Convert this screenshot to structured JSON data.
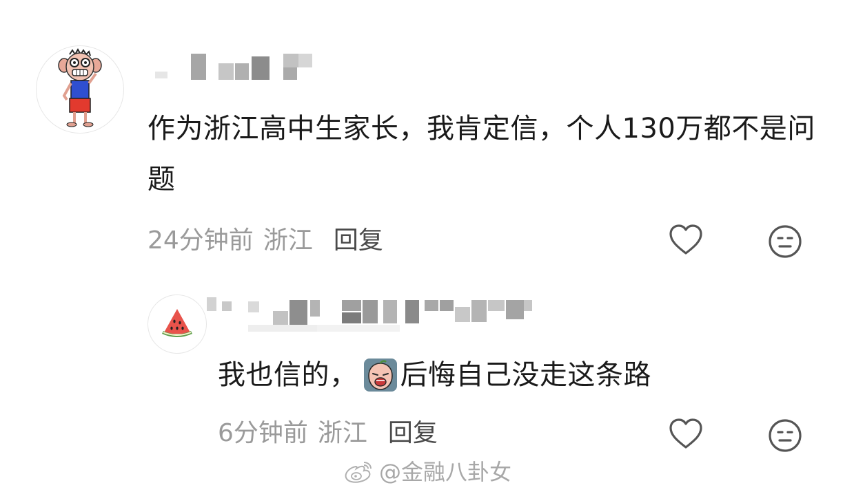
{
  "comment": {
    "text": "作为浙江高中生家长，我肯定信，个人130万都不是问题",
    "time": "24分钟前",
    "location": "浙江",
    "reply_label": "回复",
    "icons": {
      "avatar": "cartoon-boy-avatar",
      "like": "heart-outline-icon",
      "dislike": "meh-face-icon"
    }
  },
  "reply": {
    "text_before": "我也信的，",
    "text_after": "后悔自己没走这条路",
    "time": "6分钟前",
    "location": "浙江",
    "reply_label": "回复",
    "icons": {
      "avatar": "watermelon-avatar",
      "sticker": "crying-peach-emoji",
      "like": "heart-outline-icon",
      "dislike": "meh-face-icon"
    }
  },
  "watermark": {
    "text": "@金融八卦女",
    "icon": "weibo-logo-icon"
  },
  "colors": {
    "text": "#1a1a1a",
    "meta": "#9a9a9a",
    "reply_link": "#4a4a4a",
    "icon_stroke": "#555555",
    "watermark": "#a8a8a8"
  }
}
